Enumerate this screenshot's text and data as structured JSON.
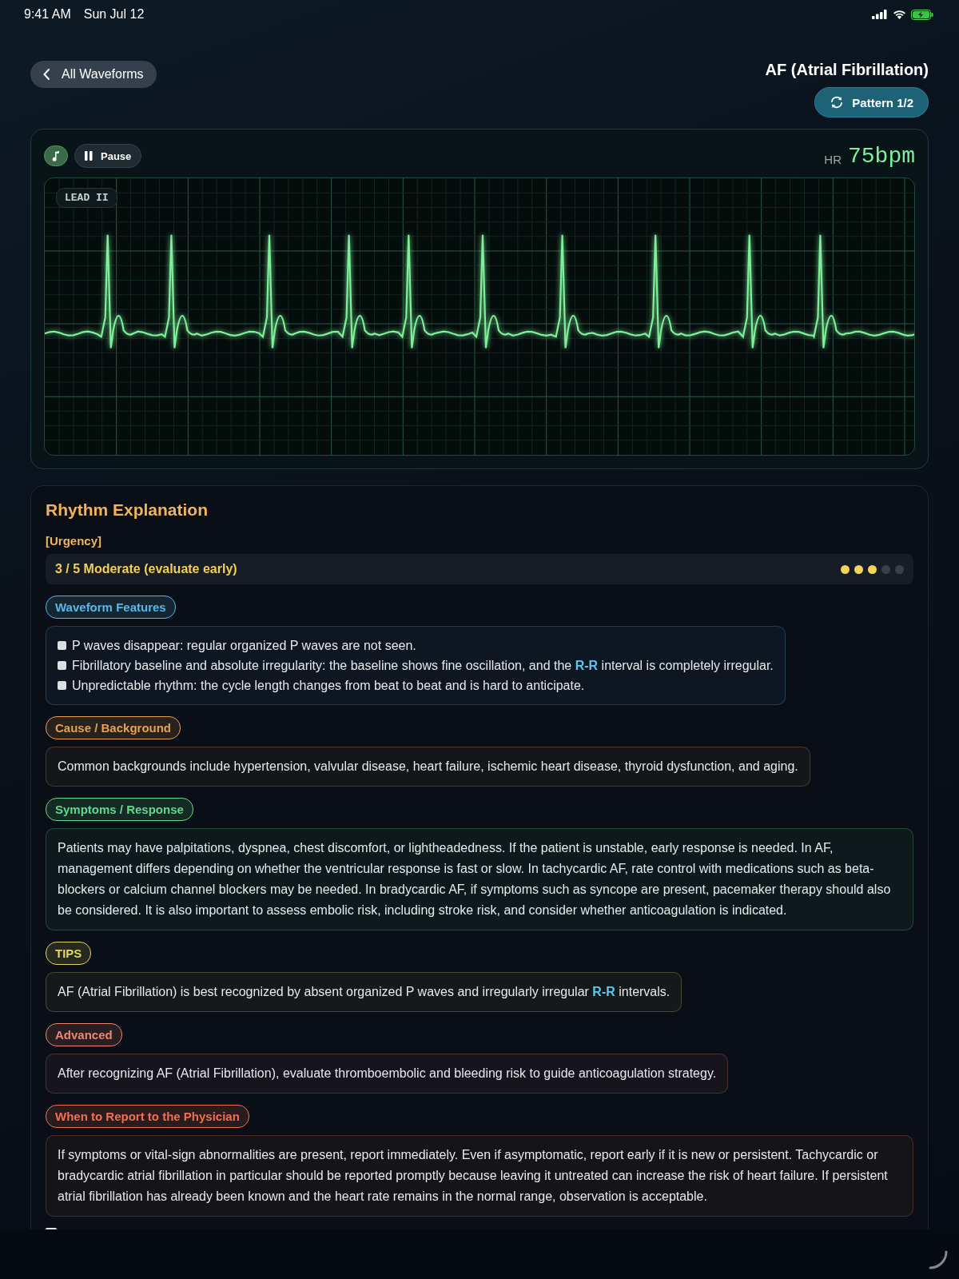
{
  "status_bar": {
    "time": "9:41 AM",
    "date": "Sun Jul 12"
  },
  "header": {
    "back_label": "All Waveforms",
    "title": "AF (Atrial Fibrillation)",
    "pattern_label": "Pattern 1/2"
  },
  "monitor": {
    "pause_label": "Pause",
    "hr_label": "HR",
    "hr_value": "75bpm",
    "lead": "LEAD II"
  },
  "explanation": {
    "title": "Rhythm Explanation",
    "urgency_label": "[Urgency]",
    "urgency_text": "3 / 5 Moderate (evaluate early)",
    "stars": 3,
    "sections": [
      {
        "kind": "list",
        "label": "Waveform Features",
        "color": "#5ab8e8",
        "items": [
          "P waves disappear: regular organized P waves are not seen.",
          "Fibrillatory baseline and absolute irregularity: the baseline shows fine oscillation, and the **R-R** interval is completely irregular.",
          "Unpredictable rhythm: the cycle length changes from beat to beat and is hard to anticipate."
        ]
      },
      {
        "kind": "text",
        "label": "Cause / Background",
        "color": "#e8a14f",
        "text": "Common backgrounds include hypertension, valvular disease, heart failure, ischemic heart disease, thyroid dysfunction, and aging."
      },
      {
        "kind": "text",
        "label": "Symptoms / Response",
        "color": "#62d98a",
        "text": "Patients may have palpitations, dyspnea, chest discomfort, or lightheadedness. If the patient is unstable, early response is needed. In AF, management differs depending on whether the ventricular response is fast or slow. In tachycardic AF, rate control with medications such as beta-blockers or calcium channel blockers may be needed. In bradycardic AF, if symptoms such as syncope are present, pacemaker therapy should also be considered. It is also important to assess embolic risk, including stroke risk, and consider whether anticoagulation is indicated."
      },
      {
        "kind": "text",
        "label": "TIPS",
        "color": "#e2d562",
        "text": "AF (Atrial Fibrillation) is best recognized by absent organized P waves and irregularly irregular **R-R** intervals."
      },
      {
        "kind": "text",
        "label": "Advanced",
        "color": "#f08473",
        "text": "After recognizing AF (Atrial Fibrillation), evaluate thromboembolic and bleeding risk to guide anticoagulation strategy."
      },
      {
        "kind": "text",
        "label": "When to Report to the Physician",
        "color": "#f2704f",
        "text": "If symptoms or vital-sign abnormalities are present, report immediately. Even if asymptomatic, report early if it is new or persistent. Tachycardic or bradycardic atrial fibrillation in particular should be reported promptly because leaving it untreated can increase the risk of heart failure. If persistent atrial fibrillation has already been known and the heart rate remains in the normal range, observation is acceptable."
      }
    ]
  }
}
